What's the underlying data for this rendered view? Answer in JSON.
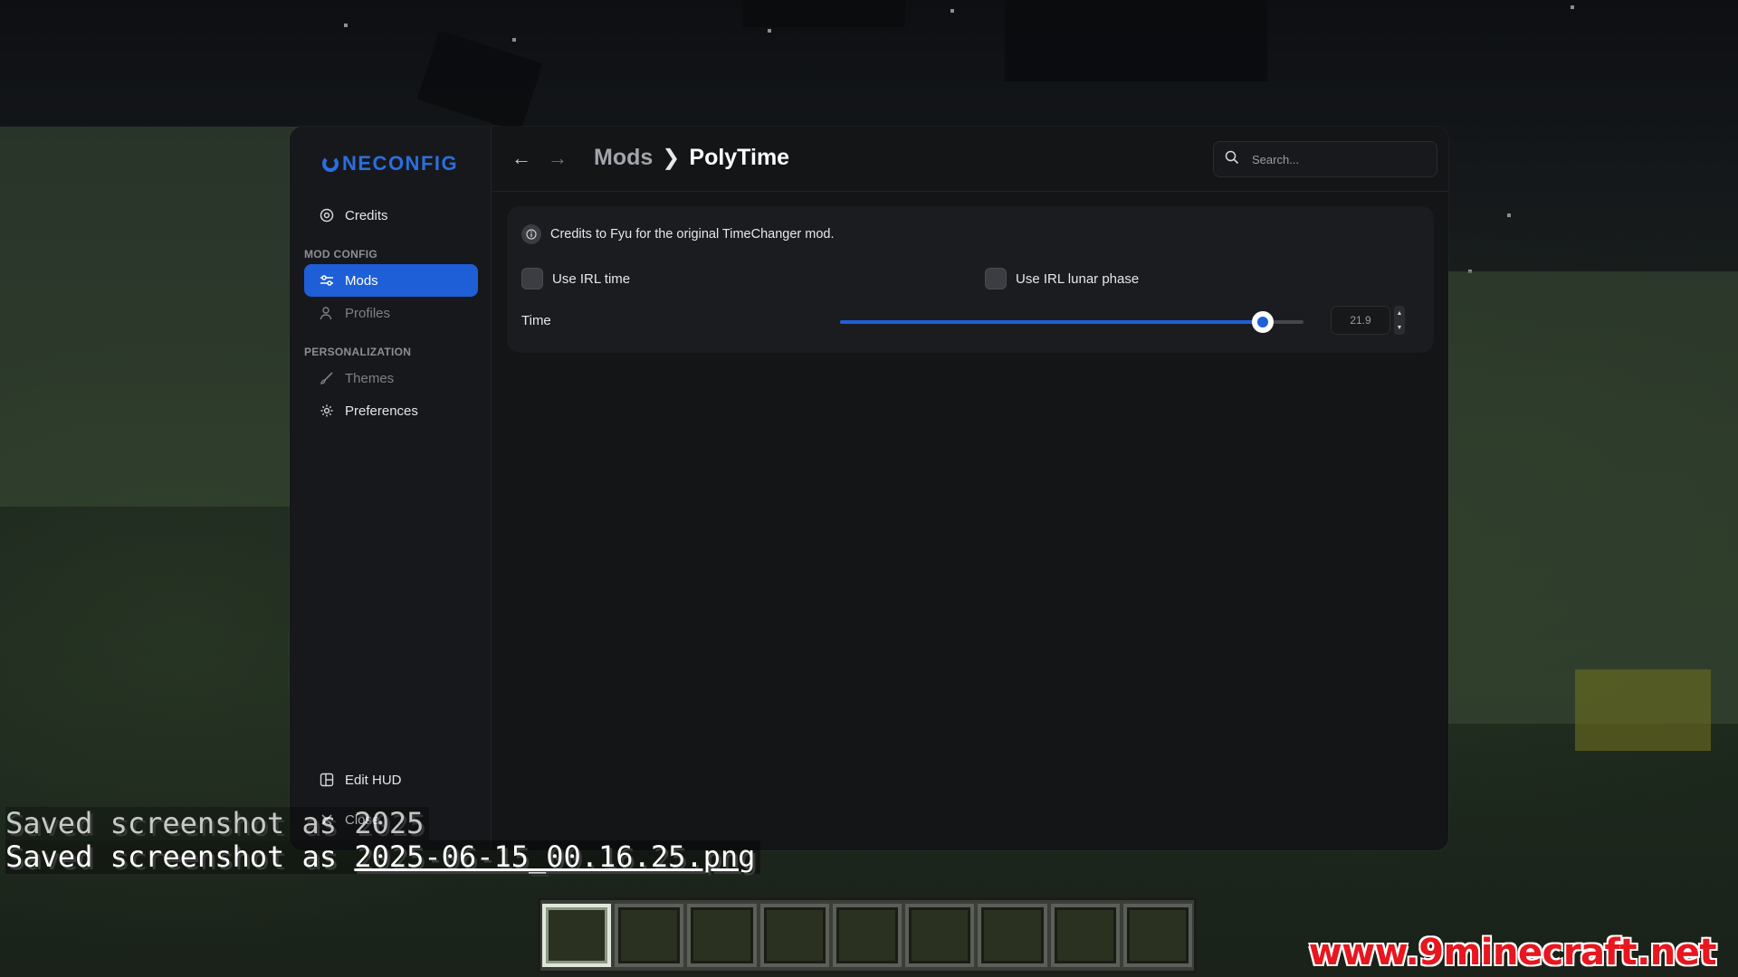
{
  "app": {
    "logo_text": "NECONFIG",
    "accent_color": "#1e5fd8"
  },
  "sidebar": {
    "credits": {
      "label": "Credits",
      "icon": "credits-icon"
    },
    "section_mod_config": "MOD CONFIG",
    "mods": {
      "label": "Mods",
      "icon": "sliders-icon",
      "active": true
    },
    "profiles": {
      "label": "Profiles",
      "icon": "user-icon"
    },
    "section_personalization": "PERSONALIZATION",
    "themes": {
      "label": "Themes",
      "icon": "brush-icon"
    },
    "preferences": {
      "label": "Preferences",
      "icon": "gear-icon"
    },
    "edit_hud": {
      "label": "Edit HUD",
      "icon": "layout-icon"
    },
    "close": {
      "label": "Close",
      "icon": "close-icon"
    }
  },
  "header": {
    "breadcrumb_parent": "Mods",
    "breadcrumb_current": "PolyTime",
    "search_placeholder": "Search..."
  },
  "content": {
    "info_text": "Credits to Fyu for the original TimeChanger mod.",
    "use_irl_time": {
      "label": "Use IRL time",
      "checked": false
    },
    "use_irl_lunar": {
      "label": "Use IRL lunar phase",
      "checked": false
    },
    "time_slider": {
      "label": "Time",
      "value": "21.9",
      "fraction": 0.913
    }
  },
  "chat": {
    "line1": "Saved screenshot as 2025",
    "line2_prefix": "Saved screenshot as ",
    "line2_file": "2025-06-15_00.16.25.png"
  },
  "hotbar": {
    "slots": 9,
    "selected": 0
  },
  "watermark": "www.9minecraft.net"
}
